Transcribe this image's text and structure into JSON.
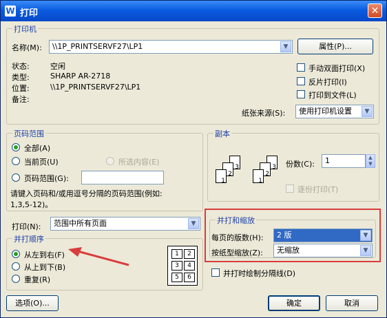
{
  "window": {
    "title": "打印",
    "app_icon": "W"
  },
  "printer": {
    "group_label": "打印机",
    "name_label": "名称(M):",
    "name_value": "\\\\1P_PRINTSERVF27\\LP1",
    "properties_button": "属性(P)...",
    "status_label": "状态:",
    "status_value": "空闲",
    "type_label": "类型:",
    "type_value": "SHARP AR-2718",
    "location_label": "位置:",
    "location_value": "\\\\1P_PRINTSERVF27\\LP1",
    "comment_label": "备注:",
    "manual_duplex": "手动双面打印(X)",
    "mirror": "反片打印(I)",
    "print_to_file": "打印到文件(L)",
    "paper_source_label": "纸张来源(S):",
    "paper_source_value": "使用打印机设置"
  },
  "page_range": {
    "group_label": "页码范围",
    "all": "全部(A)",
    "current": "当前页(U)",
    "selection": "所选内容(E)",
    "pages": "页码范围(G):",
    "pages_value": "",
    "hint_line1": "请键入页码和/或用逗号分隔的页码范围(例如:",
    "hint_line2": "1,3,5-12)。"
  },
  "print_what": {
    "label": "打印(N):",
    "value": "范围中所有页面"
  },
  "order": {
    "group_label": "并打顺序",
    "left_to_right": "从左到右(F)",
    "top_to_bottom": "从上到下(B)",
    "repeat": "重复(R)",
    "preview_numbers": [
      "1",
      "2",
      "3",
      "4",
      "5",
      "6"
    ]
  },
  "copies": {
    "group_label": "副本",
    "count_label": "份数(C):",
    "count_value": "1",
    "collate": "逐份打印(T)",
    "stack_numbers": [
      "1",
      "2",
      "3"
    ]
  },
  "zoom": {
    "group_label": "并打和缩放",
    "pages_per_sheet_label": "每页的版数(H):",
    "pages_per_sheet_value": "2 版",
    "scale_label": "按纸型缩放(Z):",
    "scale_value": "无缩放",
    "highlight_color": "#d93c3c"
  },
  "draw_separator": "并打时绘制分隔线(D)",
  "options_button": "选项(O)...",
  "ok_button": "确定",
  "cancel_button": "取消"
}
